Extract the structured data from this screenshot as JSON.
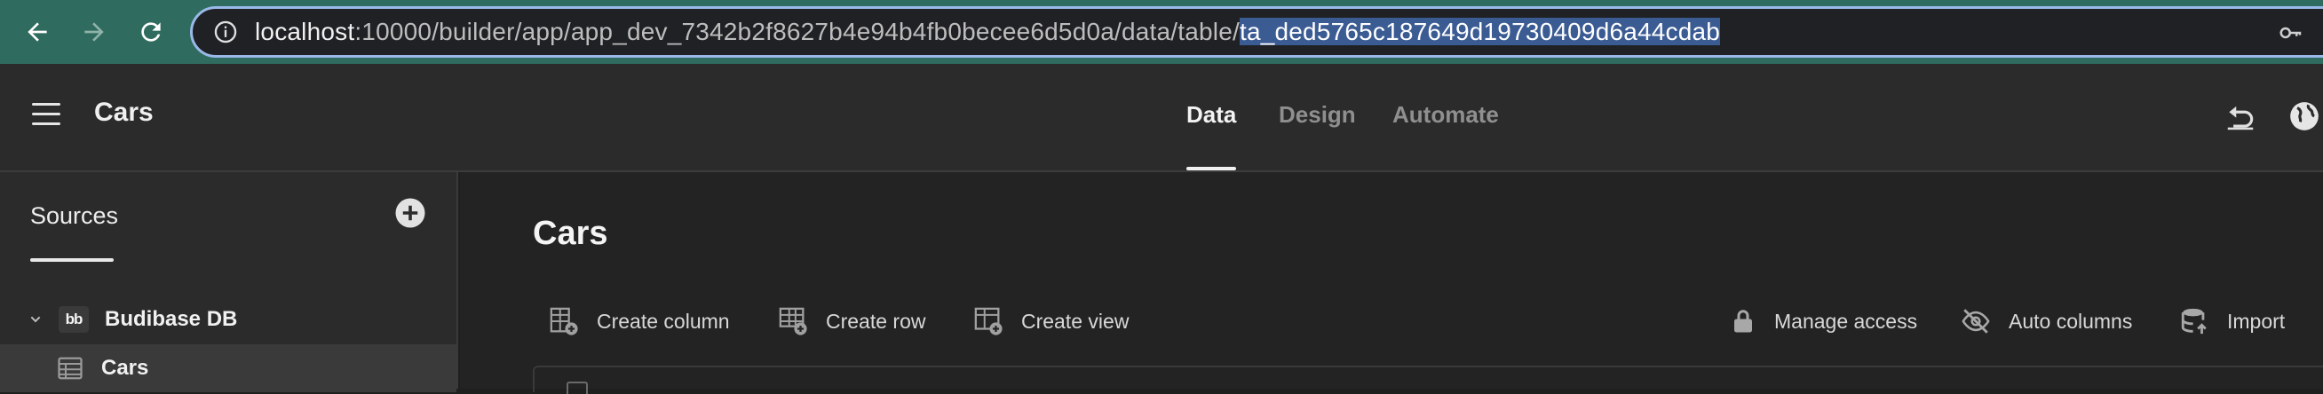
{
  "browser": {
    "url_host": "localhost",
    "url_path": ":10000/builder/app/app_dev_7342b2f8627b4e94b4fb0becee6d5d0a/data/table/",
    "url_selected": "ta_ded5765c187649d19730409d6a44cdab"
  },
  "header": {
    "app_title": "Cars",
    "tabs": [
      {
        "label": "Data"
      },
      {
        "label": "Design"
      },
      {
        "label": "Automate"
      }
    ]
  },
  "sidebar": {
    "sources_label": "Sources",
    "datasource": {
      "label": "Budibase DB",
      "logo_text": "bb"
    },
    "table": {
      "label": "Cars"
    }
  },
  "main": {
    "title": "Cars",
    "actions_left": [
      {
        "label": "Create column",
        "icon": "table-add-column-icon"
      },
      {
        "label": "Create row",
        "icon": "table-add-row-icon"
      },
      {
        "label": "Create view",
        "icon": "table-add-view-icon"
      }
    ],
    "actions_right": [
      {
        "label": "Manage access",
        "icon": "lock-icon"
      },
      {
        "label": "Auto columns",
        "icon": "eye-off-icon"
      },
      {
        "label": "Import",
        "icon": "database-import-icon"
      }
    ]
  },
  "colors": {
    "browser_bar": "#2f6b5e",
    "url_focus_ring": "#9ab8e8",
    "selection": "#3b5b93",
    "app_header": "#2b2b2b",
    "main_bg": "#232323"
  }
}
